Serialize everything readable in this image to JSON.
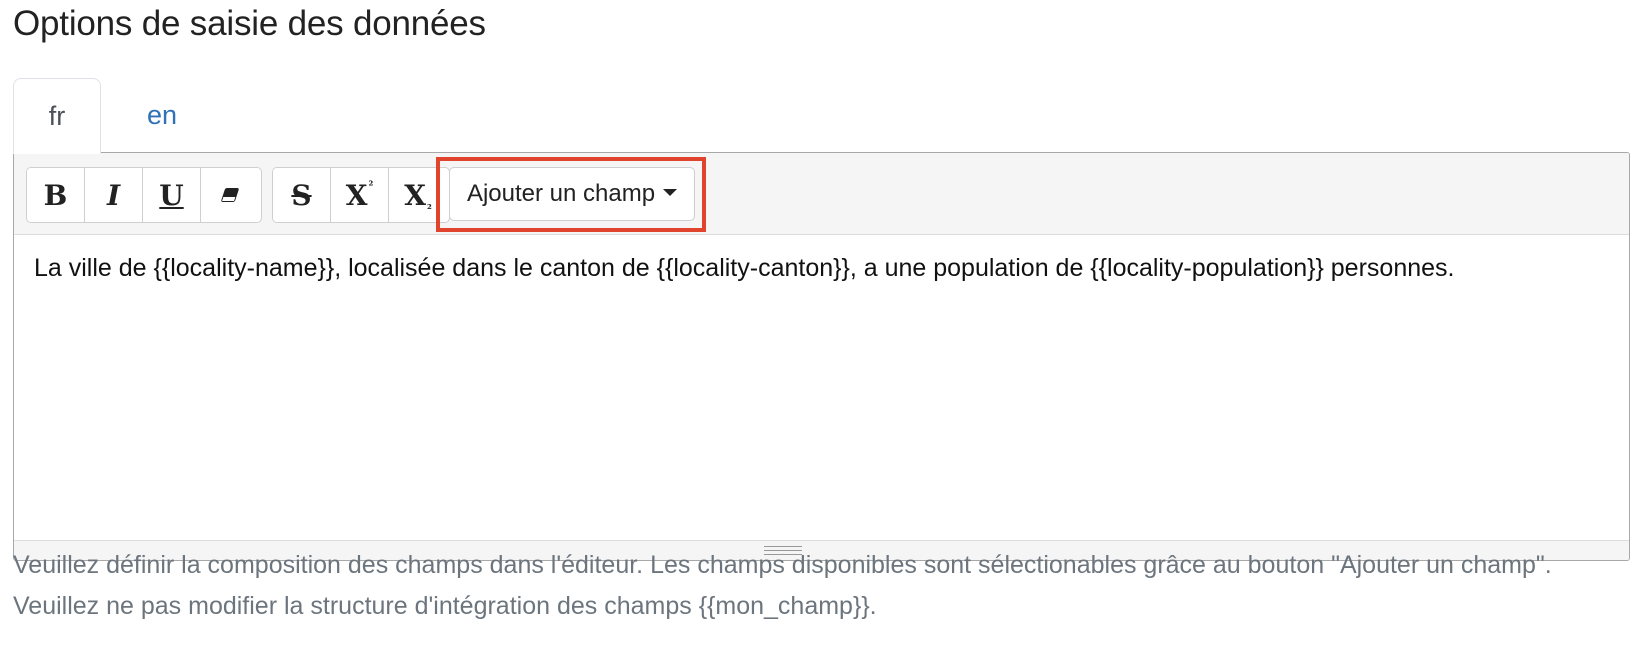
{
  "section": {
    "title": "Options de saisie des données"
  },
  "tabs": [
    {
      "label": "fr",
      "active": true
    },
    {
      "label": "en",
      "active": false
    }
  ],
  "toolbar": {
    "group1": [
      {
        "icon": "bold-icon",
        "glyph": "B"
      },
      {
        "icon": "italic-icon",
        "glyph": "I"
      },
      {
        "icon": "underline-icon",
        "glyph": "U"
      },
      {
        "icon": "eraser-icon",
        "glyph": ""
      }
    ],
    "group2": [
      {
        "icon": "strikethrough-icon",
        "glyph": "S"
      },
      {
        "icon": "superscript-icon",
        "glyph": "X",
        "mark": "²"
      },
      {
        "icon": "subscript-icon",
        "glyph": "X",
        "mark": "₂"
      }
    ],
    "add_field_label": "Ajouter un champ",
    "highlight_color": "#e0442c"
  },
  "editor": {
    "content": "La ville de {{locality-name}}, localisée dans le canton de {{locality-canton}}, a une population de {{locality-population}} personnes."
  },
  "help_text": "Veuillez définir la composition des champs dans l'éditeur. Les champs disponibles sont sélectionables grâce au bouton \"Ajouter un champ\". Veuillez ne pas modifier la structure d'intégration des champs {{mon_champ}}."
}
